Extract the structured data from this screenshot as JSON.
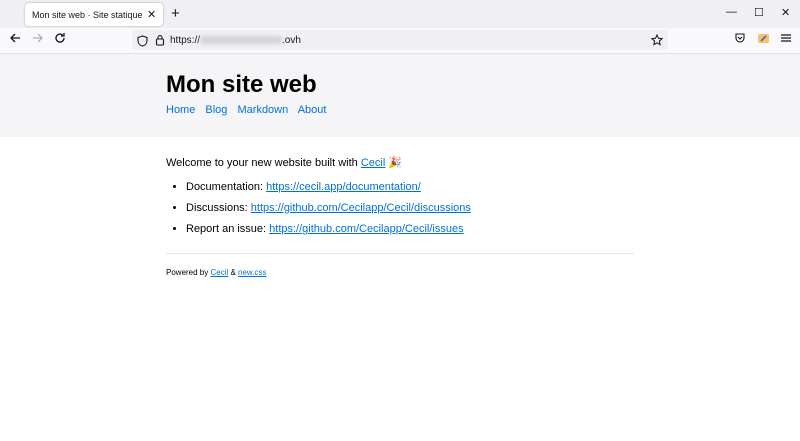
{
  "browser": {
    "tab_title": "Mon site web · Site statique généré",
    "tab_close": "✕",
    "new_tab": "+",
    "url": "https://",
    "url_suffix": ".ovh",
    "window": {
      "minimize": "—",
      "maximize": "☐",
      "close": "✕"
    },
    "icons": {
      "back": "back-arrow-icon",
      "forward": "forward-arrow-icon",
      "reload": "reload-icon",
      "shield": "tracking-shield-icon",
      "lock": "lock-icon",
      "star": "bookmark-star-icon",
      "pocket": "pocket-icon",
      "extension": "extension-icon",
      "menu": "hamburger-menu-icon"
    }
  },
  "site": {
    "title": "Mon site web",
    "nav": [
      "Home",
      "Blog",
      "Markdown",
      "About"
    ]
  },
  "content": {
    "intro_text": "Welcome to your new website built with ",
    "intro_link": "Cecil",
    "intro_emoji": "🎉",
    "items": [
      {
        "label": "Documentation: ",
        "link": "https://cecil.app/documentation/"
      },
      {
        "label": "Discussions: ",
        "link": "https://github.com/Cecilapp/Cecil/discussions"
      },
      {
        "label": "Report an issue: ",
        "link": "https://github.com/Cecilapp/Cecil/issues"
      }
    ],
    "footer": {
      "text": "Powered by ",
      "link1": "Cecil",
      "amp": " & ",
      "link2": "new.css"
    }
  },
  "colors": {
    "link": "#0070d9",
    "header_bg": "#f5f5f7",
    "chrome_bg": "#f0f0f4"
  }
}
